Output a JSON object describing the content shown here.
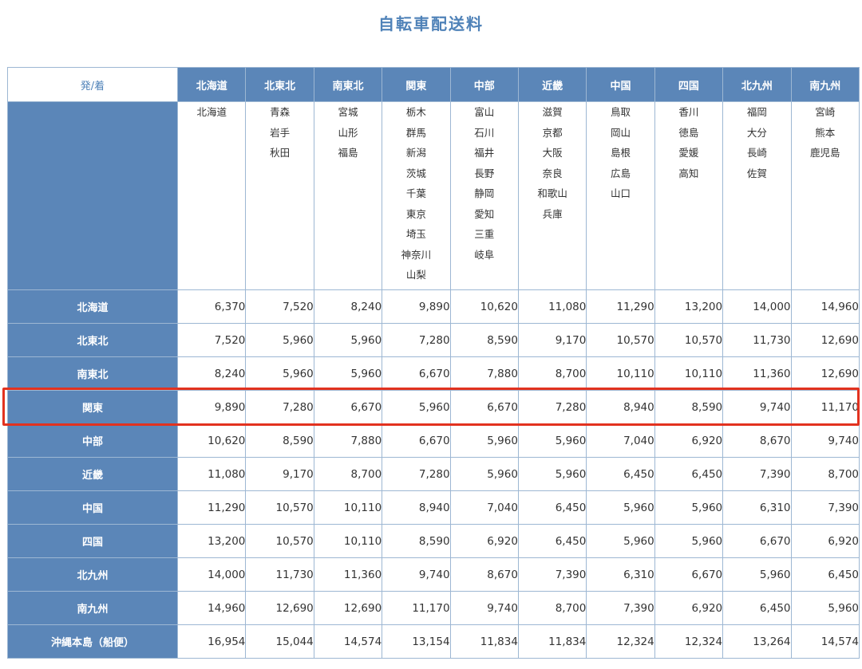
{
  "title": "自転車配送料",
  "corner_label": "発/着",
  "columns": [
    "北海道",
    "北東北",
    "南東北",
    "関東",
    "中部",
    "近畿",
    "中国",
    "四国",
    "北九州",
    "南九州"
  ],
  "prefectures": [
    [
      "北海道"
    ],
    [
      "青森",
      "岩手",
      "秋田"
    ],
    [
      "宮城",
      "山形",
      "福島"
    ],
    [
      "栃木",
      "群馬",
      "新潟",
      "茨城",
      "千葉",
      "東京",
      "埼玉",
      "神奈川",
      "山梨"
    ],
    [
      "富山",
      "石川",
      "福井",
      "長野",
      "静岡",
      "愛知",
      "三重",
      "岐阜"
    ],
    [
      "滋賀",
      "京都",
      "大阪",
      "奈良",
      "和歌山",
      "兵庫"
    ],
    [
      "鳥取",
      "岡山",
      "島根",
      "広島",
      "山口"
    ],
    [
      "香川",
      "徳島",
      "愛媛",
      "高知"
    ],
    [
      "福岡",
      "大分",
      "長崎",
      "佐賀"
    ],
    [
      "宮崎",
      "熊本",
      "鹿児島"
    ]
  ],
  "rows": [
    {
      "label": "北海道",
      "values": [
        "6,370",
        "7,520",
        "8,240",
        "9,890",
        "10,620",
        "11,080",
        "11,290",
        "13,200",
        "14,000",
        "14,960"
      ]
    },
    {
      "label": "北東北",
      "values": [
        "7,520",
        "5,960",
        "5,960",
        "7,280",
        "8,590",
        "9,170",
        "10,570",
        "10,570",
        "11,730",
        "12,690"
      ]
    },
    {
      "label": "南東北",
      "values": [
        "8,240",
        "5,960",
        "5,960",
        "6,670",
        "7,880",
        "8,700",
        "10,110",
        "10,110",
        "11,360",
        "12,690"
      ]
    },
    {
      "label": "関東",
      "values": [
        "9,890",
        "7,280",
        "6,670",
        "5,960",
        "6,670",
        "7,280",
        "8,940",
        "8,590",
        "9,740",
        "11,170"
      ]
    },
    {
      "label": "中部",
      "values": [
        "10,620",
        "8,590",
        "7,880",
        "6,670",
        "5,960",
        "5,960",
        "7,040",
        "6,920",
        "8,670",
        "9,740"
      ]
    },
    {
      "label": "近畿",
      "values": [
        "11,080",
        "9,170",
        "8,700",
        "7,280",
        "5,960",
        "5,960",
        "6,450",
        "6,450",
        "7,390",
        "8,700"
      ]
    },
    {
      "label": "中国",
      "values": [
        "11,290",
        "10,570",
        "10,110",
        "8,940",
        "7,040",
        "6,450",
        "5,960",
        "5,960",
        "6,310",
        "7,390"
      ]
    },
    {
      "label": "四国",
      "values": [
        "13,200",
        "10,570",
        "10,110",
        "8,590",
        "6,920",
        "6,450",
        "5,960",
        "5,960",
        "6,670",
        "6,920"
      ]
    },
    {
      "label": "北九州",
      "values": [
        "14,000",
        "11,730",
        "11,360",
        "9,740",
        "8,670",
        "7,390",
        "6,310",
        "6,670",
        "5,960",
        "6,450"
      ]
    },
    {
      "label": "南九州",
      "values": [
        "14,960",
        "12,690",
        "12,690",
        "11,170",
        "9,740",
        "8,700",
        "7,390",
        "6,920",
        "6,450",
        "5,960"
      ]
    },
    {
      "label": "沖縄本島（船便）",
      "values": [
        "16,954",
        "15,044",
        "14,574",
        "13,154",
        "11,834",
        "11,834",
        "12,324",
        "12,324",
        "13,264",
        "14,574"
      ]
    }
  ],
  "highlight_color": "#e2321f",
  "header_color": "#5b86b8"
}
